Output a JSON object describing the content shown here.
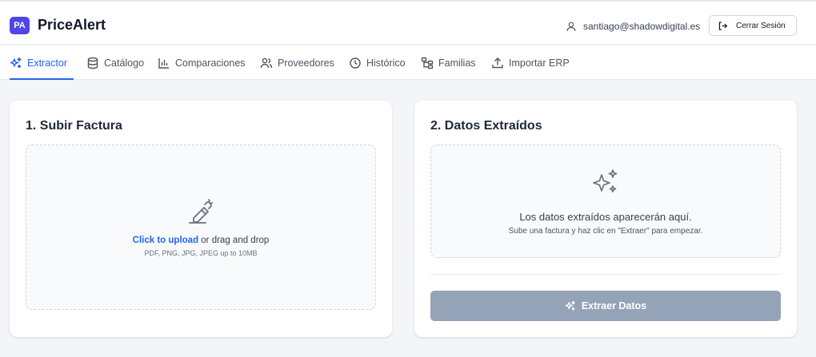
{
  "app": {
    "badge": "PA",
    "title": "PriceAlert"
  },
  "header": {
    "user_email": "santiago@shadowdigital.es",
    "logout_label": "Cerrar Sesión"
  },
  "nav": {
    "active": "Extractor",
    "tabs": [
      {
        "label": "Extractor",
        "icon": "sparkles-icon"
      },
      {
        "label": "Catálogo",
        "icon": "database-icon"
      },
      {
        "label": "Comparaciones",
        "icon": "bar-chart-icon"
      },
      {
        "label": "Proveedores",
        "icon": "users-icon"
      },
      {
        "label": "Histórico",
        "icon": "clock-icon"
      },
      {
        "label": "Familias",
        "icon": "hierarchy-icon"
      },
      {
        "label": "Importar ERP",
        "icon": "upload-icon"
      }
    ]
  },
  "upload": {
    "title": "1. Subir Factura",
    "link_text": "Click to upload",
    "rest_text": " or drag and drop",
    "hint": "PDF, PNG, JPG, JPEG up to 10MB",
    "icon": "pen-upload-icon"
  },
  "extracted": {
    "title": "2. Datos Extraídos",
    "empty_title": "Los datos extraídos aparecerán aquí.",
    "empty_subtitle": "Sube una factura y haz clic en \"Extraer\" para empezar.",
    "icon": "sparkles-icon",
    "button_label": "Extraer Datos"
  },
  "colors": {
    "accent": "#2563eb",
    "brand": "#4f46e5",
    "button_disabled": "#94a3b8"
  }
}
